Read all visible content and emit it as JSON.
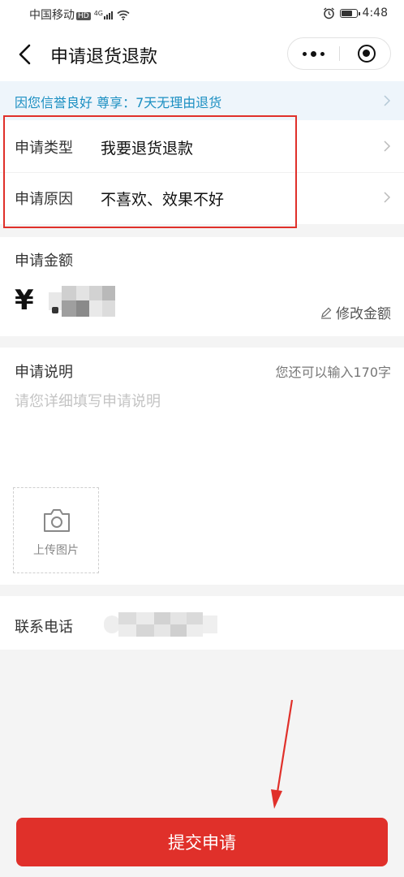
{
  "status_bar": {
    "carrier": "中国移动",
    "hd_badge": "HD",
    "network": "4G",
    "time": "4:48"
  },
  "nav": {
    "title": "申请退货退款"
  },
  "promo": {
    "text": "因您信誉良好 尊享：7天无理由退货"
  },
  "request_type": {
    "label": "申请类型",
    "value": "我要退货退款"
  },
  "request_reason": {
    "label": "申请原因",
    "value": "不喜欢、效果不好"
  },
  "amount": {
    "label": "申请金额",
    "currency": "¥",
    "edit_label": "修改金额"
  },
  "description": {
    "label": "申请说明",
    "char_counter": "您还可以输入170字",
    "placeholder": "请您详细填写申请说明"
  },
  "upload": {
    "label": "上传图片"
  },
  "phone": {
    "label": "联系电话"
  },
  "submit": {
    "label": "提交申请"
  },
  "colors": {
    "accent_red": "#e0302a",
    "promo_text": "#1b8fc2",
    "promo_bg": "#eef5fb"
  }
}
